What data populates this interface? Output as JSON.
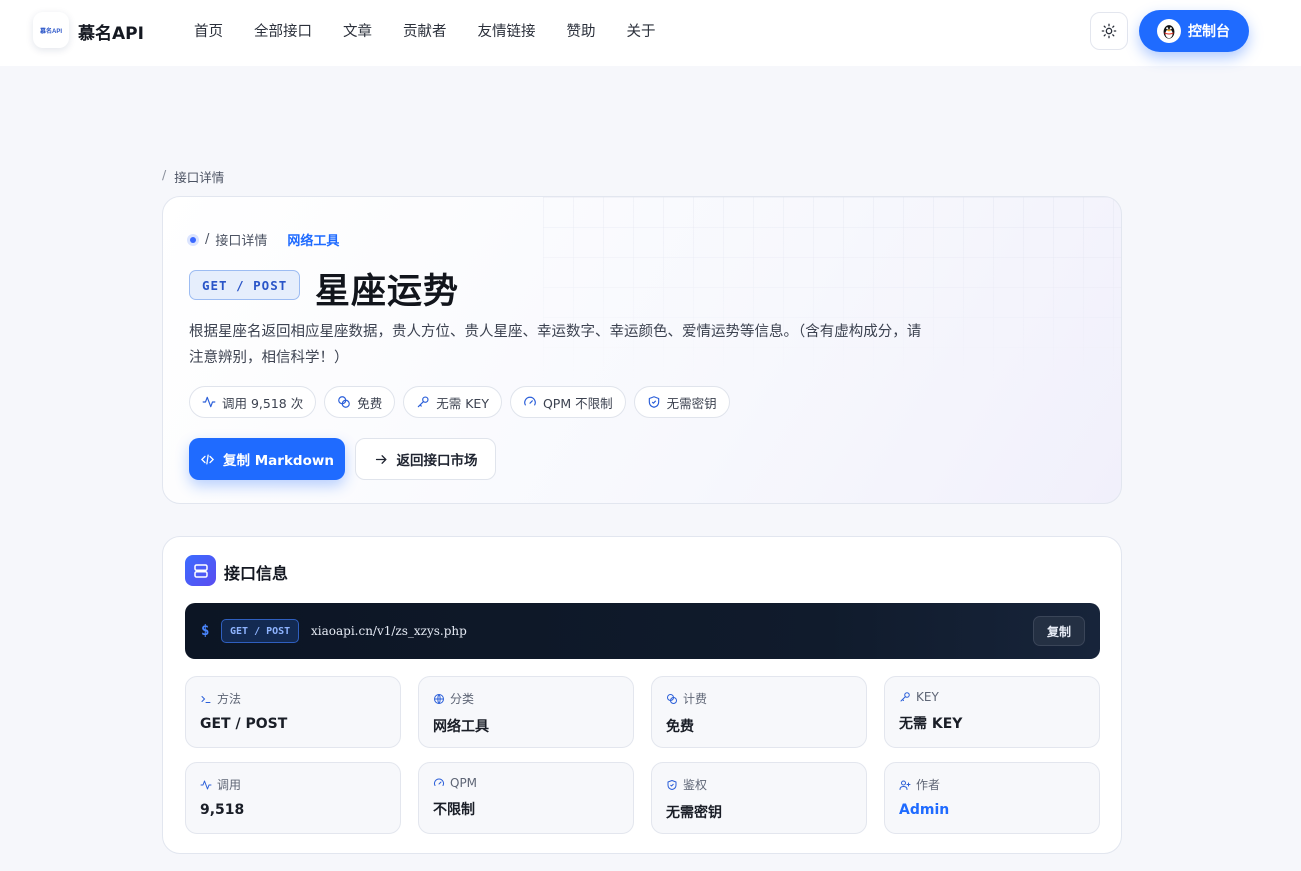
{
  "header": {
    "logo_text": "慕名API",
    "brand": "慕名API",
    "nav": [
      "首页",
      "全部接口",
      "文章",
      "贡献者",
      "友情链接",
      "赞助",
      "关于"
    ],
    "console_label": "控制台"
  },
  "breadcrumb": {
    "sep": "/",
    "current": "接口详情"
  },
  "hero": {
    "crumb_sep": "/",
    "crumb_label": "接口详情",
    "category_tag": "网络工具",
    "method": "GET / POST",
    "title": "星座运势",
    "description": "根据星座名返回相应星座数据，贵人方位、贵人星座、幸运数字、幸运颜色、爱情运势等信息。（含有虚构成分，请注意辨别，相信科学！）",
    "chips": {
      "calls": "调用 9,518 次",
      "price": "免费",
      "key": "无需 KEY",
      "qpm": "QPM 不限制",
      "auth": "无需密钥"
    },
    "copy_markdown": "复制 Markdown",
    "back_market": "返回接口市场"
  },
  "info": {
    "title": "接口信息",
    "terminal": {
      "prompt": "$",
      "method": "GET / POST",
      "url": "xiaoapi.cn/v1/zs_xzys.php",
      "copy": "复制"
    },
    "cells": [
      {
        "label": "方法",
        "value": "GET / POST",
        "icon": "terminal-icon"
      },
      {
        "label": "分类",
        "value": "网络工具",
        "icon": "globe-icon"
      },
      {
        "label": "计费",
        "value": "免费",
        "icon": "coins-icon"
      },
      {
        "label": "KEY",
        "value": "无需 KEY",
        "icon": "key-icon"
      },
      {
        "label": "调用",
        "value": "9,518",
        "icon": "activity-icon"
      },
      {
        "label": "QPM",
        "value": "不限制",
        "icon": "gauge-icon"
      },
      {
        "label": "鉴权",
        "value": "无需密钥",
        "icon": "shield-icon"
      },
      {
        "label": "作者",
        "value": "Admin",
        "icon": "user-plus-icon"
      }
    ]
  },
  "colors": {
    "accent": "#1f6bff",
    "background": "#f6f7fb",
    "terminal_bg": "#0c1524"
  }
}
